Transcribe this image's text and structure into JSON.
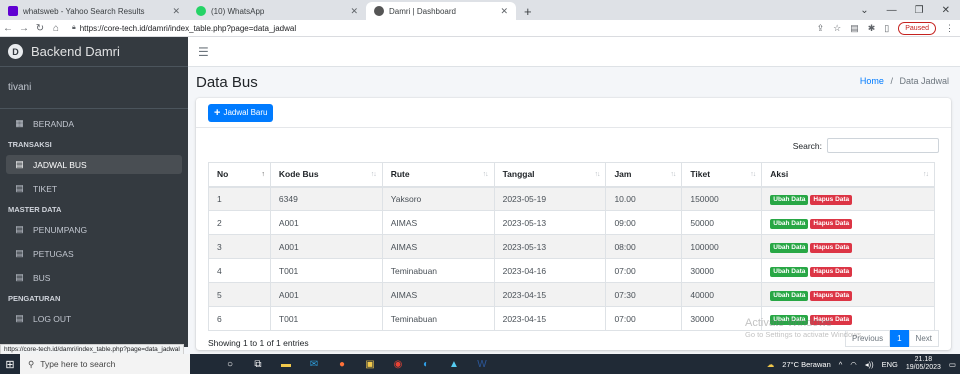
{
  "browser": {
    "tabs": [
      {
        "label": "whatsweb - Yahoo Search Results",
        "favicon_color": "#6001d2",
        "close": "✕"
      },
      {
        "label": "(10) WhatsApp",
        "favicon_color": "#25d366",
        "close": ""
      },
      {
        "label": "Damri | Dashboard",
        "favicon_color": "#555555",
        "close": "✕"
      }
    ],
    "new_tab": "+",
    "url": "https://core-tech.id/damri/index_table.php?page=data_jadwal",
    "paused_label": "Paused",
    "status_url": "https://core-tech.id/damri/index_table.php?page=data_jadwal"
  },
  "sidebar": {
    "brand": "Backend Damri",
    "brand_logo": "D",
    "user": "tivani",
    "groups": [
      {
        "items": [
          {
            "label": "BERANDA",
            "icon": "grid-icon",
            "active": false
          }
        ]
      },
      {
        "header": "TRANSAKSI",
        "items": [
          {
            "label": "JADWAL BUS",
            "icon": "calendar-icon",
            "active": true
          },
          {
            "label": "TIKET",
            "icon": "calendar-icon",
            "active": false
          }
        ]
      },
      {
        "header": "MASTER DATA",
        "items": [
          {
            "label": "PENUMPANG",
            "icon": "calendar-icon",
            "active": false
          },
          {
            "label": "PETUGAS",
            "icon": "calendar-icon",
            "active": false
          },
          {
            "label": "BUS",
            "icon": "calendar-icon",
            "active": false
          }
        ]
      },
      {
        "header": "PENGATURAN",
        "items": [
          {
            "label": "LOG OUT",
            "icon": "calendar-icon",
            "active": false
          }
        ]
      }
    ]
  },
  "main": {
    "title": "Data Bus",
    "breadcrumb_home": "Home",
    "breadcrumb_sep": "/",
    "breadcrumb_current": "Data Jadwal",
    "add_button": "Jadwal Baru",
    "search_label": "Search:",
    "columns": [
      "No",
      "Kode Bus",
      "Rute",
      "Tanggal",
      "Jam",
      "Tiket",
      "Aksi"
    ],
    "rows": [
      [
        "1",
        "6349",
        "Yaksoro",
        "2023-05-19",
        "10.00",
        "150000"
      ],
      [
        "2",
        "A001",
        "AIMAS",
        "2023-05-13",
        "09:00",
        "50000"
      ],
      [
        "3",
        "A001",
        "AIMAS",
        "2023-05-13",
        "08:00",
        "100000"
      ],
      [
        "4",
        "T001",
        "Teminabuan",
        "2023-04-16",
        "07:00",
        "30000"
      ],
      [
        "5",
        "A001",
        "AIMAS",
        "2023-04-15",
        "07:30",
        "40000"
      ],
      [
        "6",
        "T001",
        "Teminabuan",
        "2023-04-15",
        "07:00",
        "30000"
      ]
    ],
    "edit_label": "Ubah Data",
    "delete_label": "Hapus Data",
    "showing": "Showing 1 to 1 of 1 entries",
    "pager_prev": "Previous",
    "pager_current": "1",
    "pager_next": "Next"
  },
  "watermark": {
    "title": "Activate Windows",
    "sub": "Go to Settings to activate Windows."
  },
  "taskbar": {
    "search_placeholder": "Type here to search",
    "weather": "27°C Berawan",
    "lang": "ENG",
    "time": "21.18",
    "date": "19/05/2023"
  },
  "colors": {
    "primary": "#007bff",
    "success": "#28a745",
    "danger": "#dc3545",
    "sidebar": "#343a40"
  }
}
